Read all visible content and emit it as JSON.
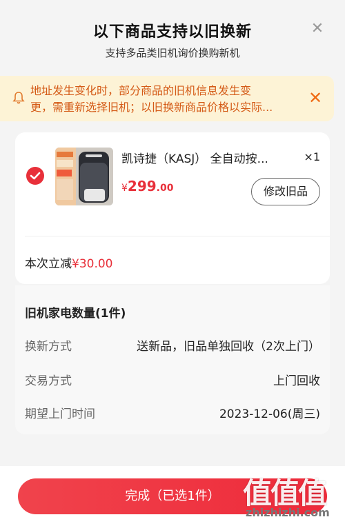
{
  "header": {
    "title": "以下商品支持以旧换新",
    "subtitle": "支持多品类旧机询价换购新机",
    "close_icon": "close-icon"
  },
  "notice": {
    "line1": "地址发生变化时，部分商品的旧机信息发生变",
    "line2": "更，需重新选择旧机；以旧换新商品价格以实际...",
    "bell_icon": "bell-icon",
    "close_icon": "close-icon"
  },
  "product": {
    "name": "凯诗捷（KASJ） 全自动按...",
    "quantity": "×1",
    "price_currency": "¥",
    "price_int": "299",
    "price_dec": ".00",
    "modify_label": "修改旧品",
    "selected": true,
    "reduce_label": "本次立减",
    "reduce_amount": "¥30.00"
  },
  "old_appliance": {
    "title": "旧机家电数量(1件)",
    "rows": [
      {
        "label": "换新方式",
        "value": "送新品，旧品单独回收（2次上门）"
      },
      {
        "label": "交易方式",
        "value": "上门回收"
      },
      {
        "label": "期望上门时间",
        "value": "2023-12-06(周三)"
      }
    ]
  },
  "footer": {
    "done_label": "完成（已选1件）"
  },
  "watermark": {
    "chars": "值值值",
    "url": "zhizhizhi.com"
  },
  "colors": {
    "accent": "#e8303a",
    "notice_bg": "#fdf3d6",
    "notice_text": "#d45a16"
  }
}
